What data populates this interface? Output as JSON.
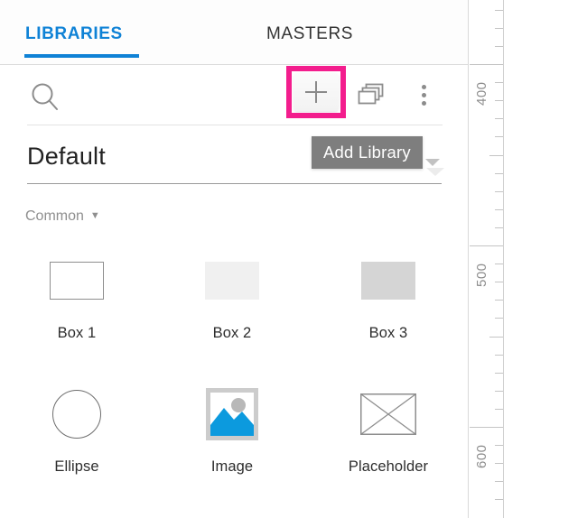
{
  "panel": {
    "tabs": [
      {
        "label": "LIBRARIES",
        "active": true
      },
      {
        "label": "MASTERS",
        "active": false
      }
    ],
    "toolbar": {
      "search_icon": "search-icon",
      "add_label": "+",
      "add_icon": "plus-icon",
      "duplicate_icon": "duplicate-libraries-icon",
      "overflow_icon": "kebab-menu-icon"
    },
    "library_select": {
      "value": "Default",
      "caret_icon": "chevron-down-icon"
    },
    "category": {
      "label": "Common",
      "caret": "▼"
    },
    "widgets": [
      [
        {
          "name": "Box 1",
          "shape": "outline-rect"
        },
        {
          "name": "Box 2",
          "shape": "light-filled-rect"
        },
        {
          "name": "Box 3",
          "shape": "gray-filled-rect"
        }
      ],
      [
        {
          "name": "Ellipse",
          "shape": "circle"
        },
        {
          "name": "Image",
          "shape": "image-thumbnail"
        },
        {
          "name": "Placeholder",
          "shape": "crossed-rect"
        }
      ]
    ]
  },
  "tooltip": {
    "text": "Add Library"
  },
  "ruler": {
    "orientation": "vertical",
    "labels": [
      "400",
      "500",
      "600"
    ],
    "label_positions": [
      71,
      272,
      473
    ],
    "unit_spacing_px": 201,
    "minor_step_units": 10
  },
  "colors": {
    "accent_blue": "#0f82d6",
    "highlight_pink": "#f31d8d",
    "tooltip_gray": "#7e7e7e",
    "image_blue": "#0c9ade",
    "text_dark": "#2d2d2d",
    "muted_gray": "#8f8f8f"
  }
}
